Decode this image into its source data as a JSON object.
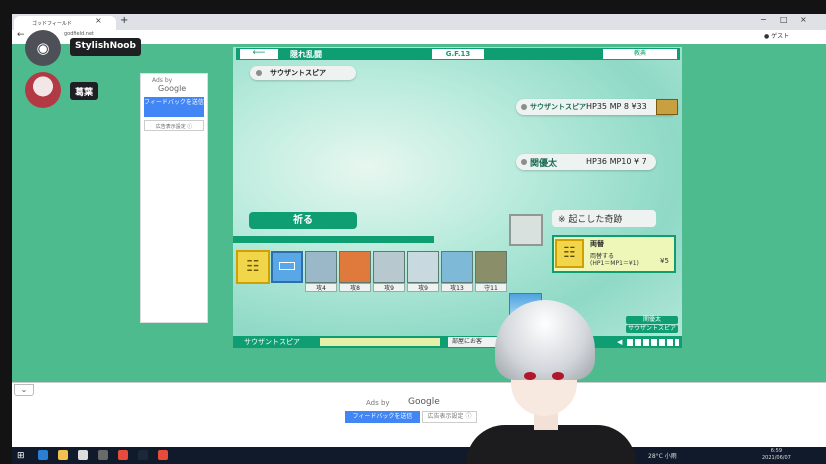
{
  "browser": {
    "tab_title": "ゴッドフィールド",
    "tab_close": "×",
    "new_tab": "+",
    "url": "godfield.net",
    "profile": "ゲスト",
    "window_controls": [
      "−",
      "□",
      "×"
    ]
  },
  "discord": {
    "users": [
      {
        "name": "StylishNoob",
        "avatar": "discord-logo"
      },
      {
        "name": "葛葉",
        "avatar": "character"
      }
    ]
  },
  "side_ad": {
    "title": "Ads by",
    "google": "Google",
    "feedback": "フィードバックを送信",
    "why": "広告表示設定 ⓘ"
  },
  "game": {
    "back": "⟵",
    "floor_name": "隠れ乱闘",
    "gf": "G.F.13",
    "tutorial": "教典",
    "player_chip": "サウザントスピア",
    "units": [
      {
        "name": "サウザントスピア",
        "hp": 35,
        "mp": 8,
        "yen": 33
      },
      {
        "name": "関優太",
        "hp": 36,
        "mp": 10,
        "yen": 7
      }
    ],
    "unit_stats_text": [
      "HP35  MP 8  ¥33",
      "HP36  MP10  ¥ 7"
    ],
    "pray": "祈る",
    "miracle_label": "※ 起こした奇跡",
    "card": {
      "icon": "☷",
      "title": "両替",
      "desc_1": "両替する",
      "desc_2": "(HP1＝MP1＝¥1)",
      "cost": "¥5"
    },
    "hand_labels": [
      "攻4",
      "攻8",
      "攻9",
      "攻9",
      "攻13",
      "守11"
    ],
    "hand_colors": [
      "#9bb8c9",
      "#e07a3c",
      "#b7c9cf",
      "#c9d9e0",
      "#7fb9d8",
      "#8a8f6a"
    ],
    "enemy_tags": [
      "関優太",
      "サウザントスピア"
    ],
    "status_name": "サウザントスピア",
    "status_msg": "部屋にお客",
    "volume_icon": "◀"
  },
  "bottom_ad": {
    "collapse": "⌄",
    "title": "Ads by",
    "google": "Google",
    "feedback": "フィードバックを送信",
    "why": "広告表示設定 ⓘ"
  },
  "taskbar": {
    "start": "⊞",
    "weather": "28°C 小雨",
    "time": "6:59",
    "date": "2021/06/07"
  },
  "colors": {
    "game_green": "#0f9e72",
    "page_green": "#4dbb8d",
    "card_yellow": "#f1d54a",
    "ad_blue": "#4285f4"
  }
}
